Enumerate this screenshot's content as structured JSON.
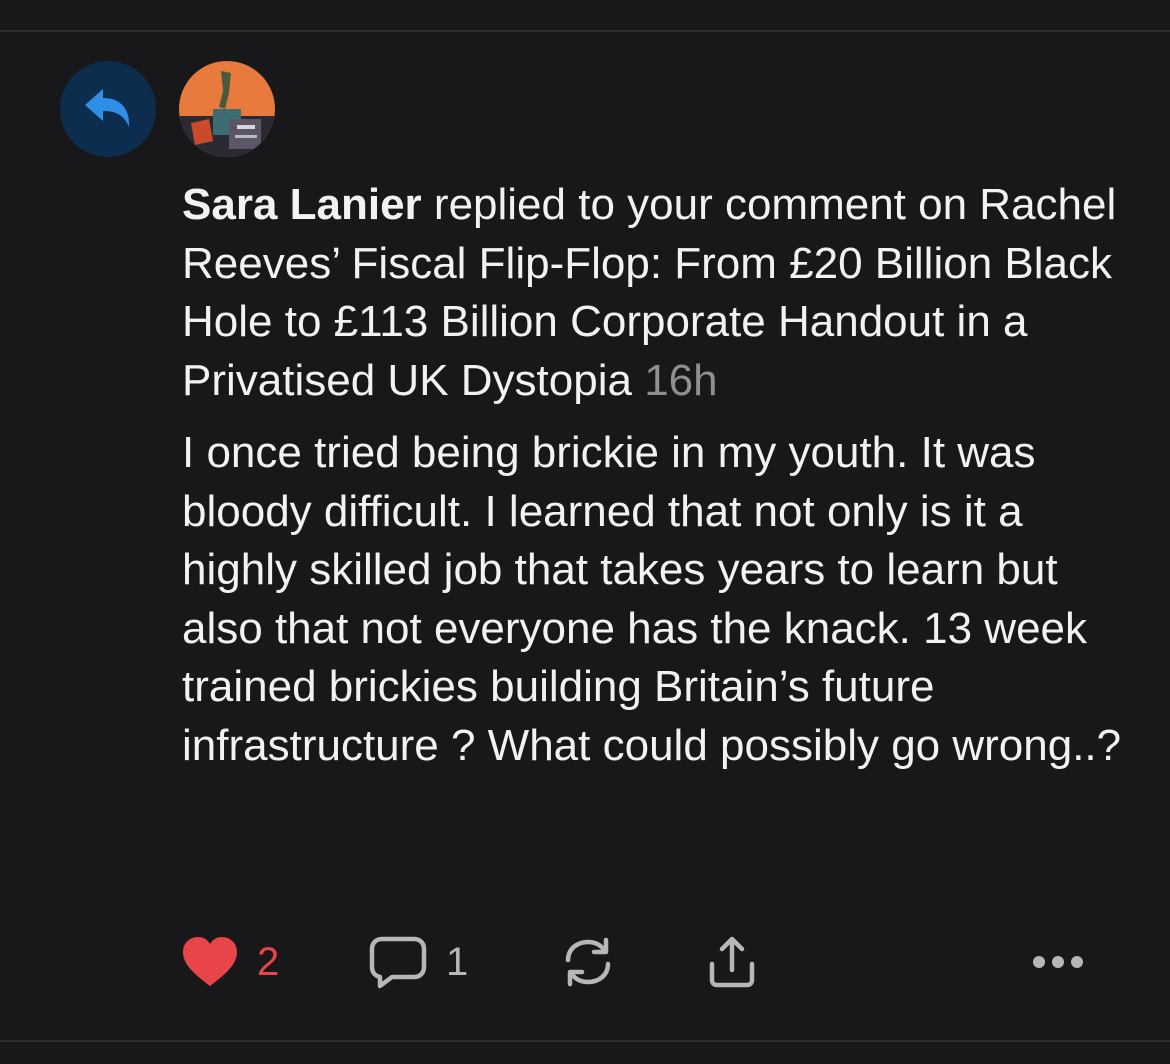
{
  "notification": {
    "author": "Sara Lanier",
    "action": " replied to your comment on Rachel Reeves’ Fiscal Flip-Flop: From £20 Billion Black Hole to £113 Billion Corporate Handout in a Privatised UK Dystopia",
    "time": "16h",
    "body": "I once tried being brickie in my youth. It was bloody difficult. I learned that not only is it a highly skilled job that takes years to learn but also that not everyone has the knack. 13 week trained brickies building Britain’s future infrastructure ? What could possibly go wrong..?"
  },
  "icons": {
    "badge": "reply-arrow-icon",
    "like": "heart-icon",
    "comment": "comment-bubble-icon",
    "restack": "restack-icon",
    "share": "share-icon",
    "more": "more-dots-icon"
  },
  "actions": {
    "likes": "2",
    "comments": "1"
  },
  "colors": {
    "background": "#18181a",
    "badge_bg": "#0c2d4d",
    "badge_icon": "#2f8fe6",
    "heart": "#e8454b",
    "muted": "#8e8e93"
  }
}
